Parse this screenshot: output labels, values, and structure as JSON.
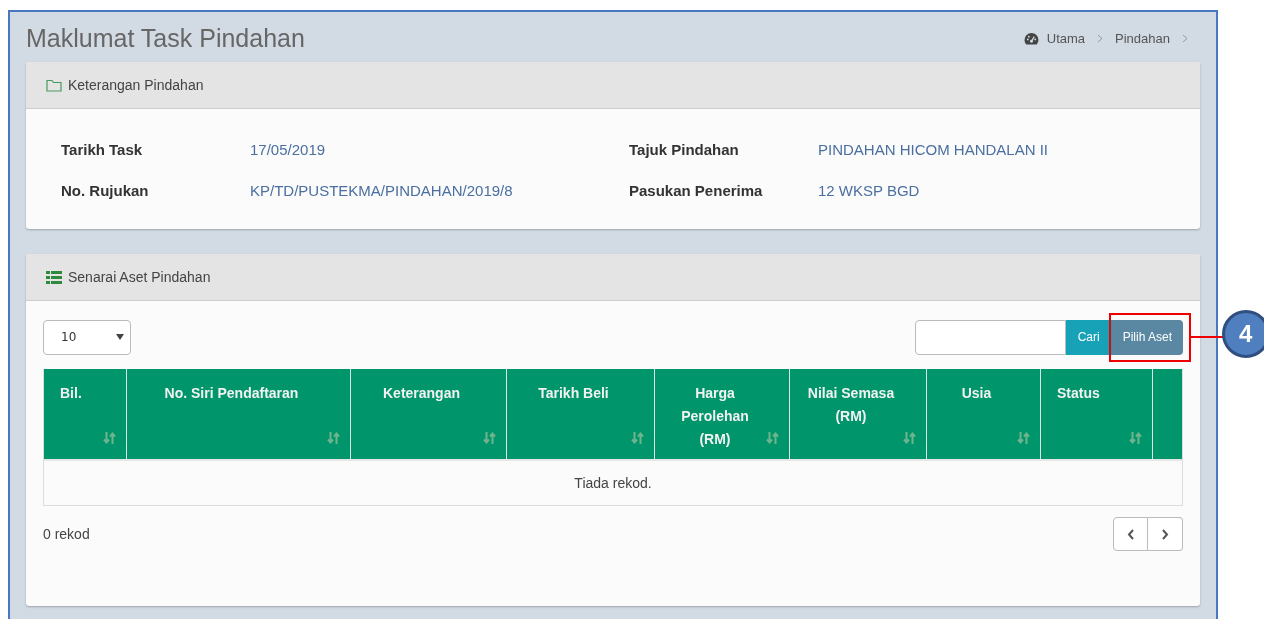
{
  "page": {
    "title": "Maklumat Task Pindahan"
  },
  "breadcrumb": [
    {
      "label": "Utama",
      "kind": "home"
    },
    {
      "label": "Pindahan",
      "kind": "plain"
    }
  ],
  "details_panel": {
    "title": "Keterangan Pindahan",
    "fields": [
      {
        "label": "Tarikh Task",
        "value": "17/05/2019"
      },
      {
        "label": "Tajuk Pindahan",
        "value": "PINDAHAN HICOM HANDALAN II"
      },
      {
        "label": "No. Rujukan",
        "value": "KP/TD/PUSTEKMA/PINDAHAN/2019/8"
      },
      {
        "label": "Pasukan Penerima",
        "value": "12 WKSP BGD"
      }
    ]
  },
  "assets_panel": {
    "title": "Senarai Aset Pindahan",
    "page_size": "10",
    "search": {
      "button": "Cari"
    },
    "action_button": "Pilih Aset",
    "table": {
      "columns": [
        {
          "label": "Bil."
        },
        {
          "label": "No. Siri Pendaftaran"
        },
        {
          "label": "Keterangan"
        },
        {
          "label": "Tarikh Beli"
        },
        {
          "label": "Harga Perolehan (RM)"
        },
        {
          "label": "Nilai Semasa (RM)"
        },
        {
          "label": "Usia"
        },
        {
          "label": "Status"
        }
      ],
      "empty_message": "Tiada rekod."
    },
    "record_count": "0 rekod"
  },
  "callout": {
    "number": "4"
  }
}
